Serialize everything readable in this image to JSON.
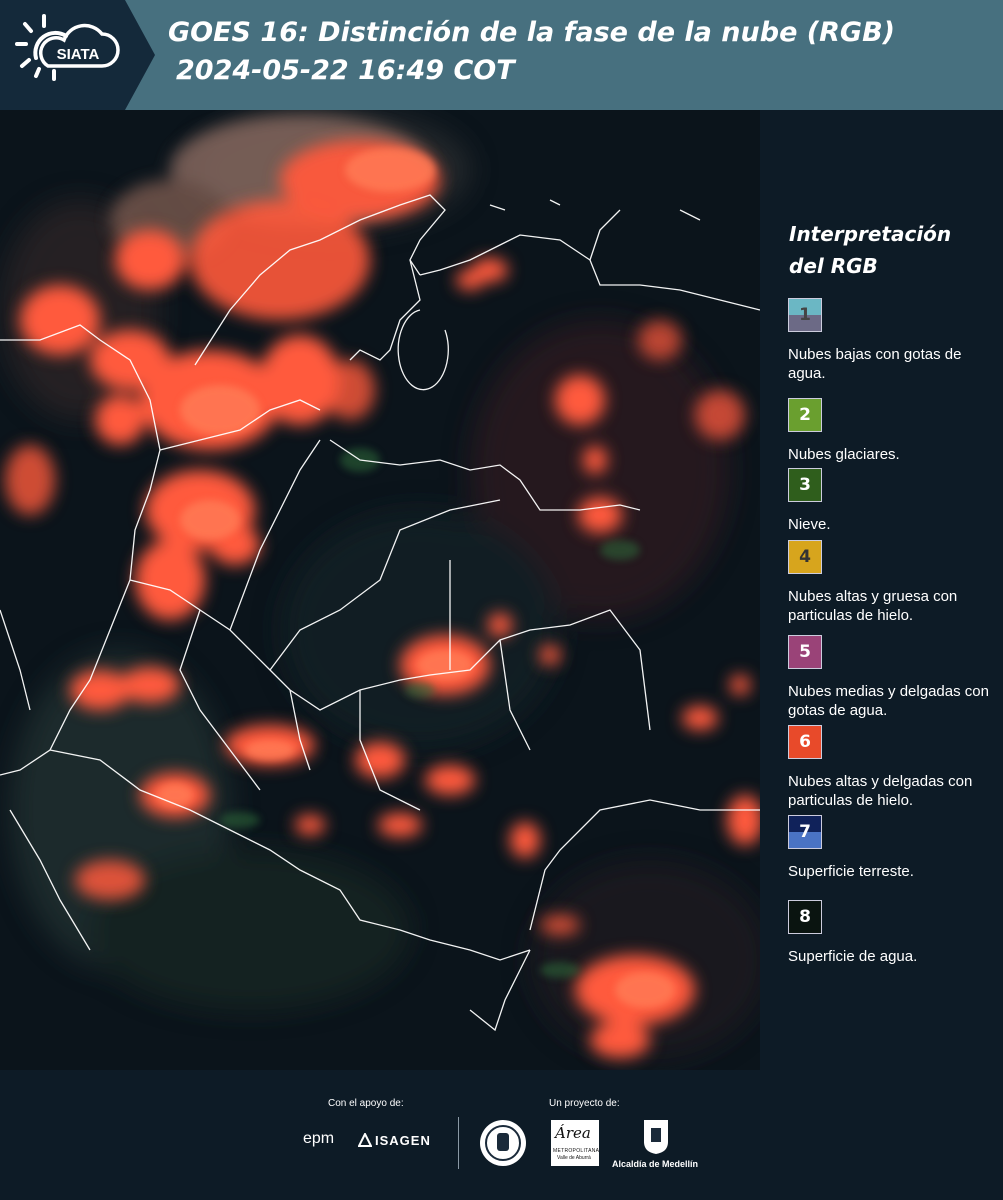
{
  "header": {
    "logo_text": "SIATA",
    "title_line1": "GOES 16: Distinción de la fase de la nube (RGB)",
    "title_line2": "2024-05-22 16:49 COT"
  },
  "legend": {
    "title": "Interpretación del RGB",
    "items": [
      {
        "number": "1",
        "label": "Nubes bajas con gotas de agua.",
        "color_top": "#6bb7c4",
        "color_bottom": "#6c6a86",
        "text_color": "#444"
      },
      {
        "number": "2",
        "label": "Nubes glaciares.",
        "color_top": "#6a9f2f",
        "color_bottom": "#6a9f2f",
        "text_color": "#fff"
      },
      {
        "number": "3",
        "label": "Nieve.",
        "color_top": "#2f5e1c",
        "color_bottom": "#2f5e1c",
        "text_color": "#fff"
      },
      {
        "number": "4",
        "label": "Nubes altas y gruesa con particulas de hielo.",
        "color_top": "#d7a51d",
        "color_bottom": "#d7a51d",
        "text_color": "#333"
      },
      {
        "number": "5",
        "label": "Nubes medias y delgadas con gotas de agua.",
        "color_top": "#9a4378",
        "color_bottom": "#9a4378",
        "text_color": "#fff"
      },
      {
        "number": "6",
        "label": "Nubes altas y delgadas con particulas de hielo.",
        "color_top": "#e84a2a",
        "color_bottom": "#e84a2a",
        "text_color": "#fff"
      },
      {
        "number": "7",
        "label": "Superficie terreste.",
        "color_top": "#10225a",
        "color_bottom": "#4a73c4",
        "text_color": "#fff"
      },
      {
        "number": "8",
        "label": "Superficie de agua.",
        "color_top": "#0a1410",
        "color_bottom": "#0a1410",
        "text_color": "#fff"
      }
    ]
  },
  "footer": {
    "support_label": "Con el apoyo de:",
    "project_label": "Un proyecto de:",
    "logo_epm": "epm",
    "logo_isagen": "ISAGEN",
    "logo_area_title": "Área",
    "logo_area_sub1": "METROPOLITANA",
    "logo_area_sub2": "Valle de Aburrá",
    "logo_alcaldia": "Alcaldía de Medellín"
  },
  "colors": {
    "header_bg": "#47707f",
    "logo_panel_bg": "#14293a",
    "page_bg": "#0d1b26",
    "cloud_high_thin": "#ff5a3c"
  }
}
